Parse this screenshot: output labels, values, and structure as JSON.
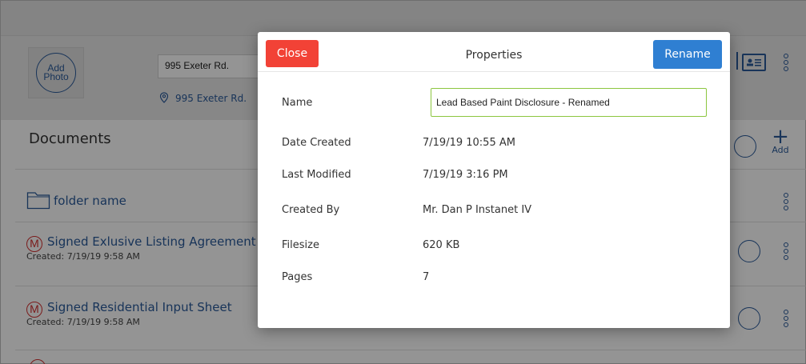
{
  "header": {
    "add_photo_label": "Add\nPhoto",
    "address_value": "995 Exeter Rd.",
    "address_link": "995 Exeter Rd."
  },
  "documents": {
    "title": "Documents",
    "add_label": "Add",
    "folder": {
      "name": "folder name"
    },
    "items": [
      {
        "badge": "M",
        "title": "Signed Exlusive Listing Agreement",
        "created": "Created: 7/19/19 9:58 AM"
      },
      {
        "badge": "M",
        "title": "Signed Residential Input Sheet",
        "created": "Created: 7/19/19 9:58 AM"
      }
    ]
  },
  "modal": {
    "title": "Properties",
    "close_label": "Close",
    "rename_label": "Rename",
    "fields": {
      "name_label": "Name",
      "name_value": "Lead Based Paint Disclosure - Renamed",
      "date_created_label": "Date Created",
      "date_created_value": "7/19/19 10:55 AM",
      "last_modified_label": "Last Modified",
      "last_modified_value": "7/19/19 3:16 PM",
      "created_by_label": "Created By",
      "created_by_value": "Mr. Dan P Instanet IV",
      "filesize_label": "Filesize",
      "filesize_value": "620 KB",
      "pages_label": "Pages",
      "pages_value": "7"
    }
  },
  "colors": {
    "brand_blue": "#2a5a9a",
    "close_red": "#f24236",
    "rename_blue": "#2f7fd2",
    "input_focus": "#8cc63f",
    "badge_red": "#d32f2f"
  },
  "icons": [
    "add-photo-icon",
    "map-pin-icon",
    "contact-card-icon",
    "more-vertical-icon",
    "folder-icon",
    "m-badge-icon",
    "select-circle-icon",
    "plus-icon"
  ]
}
